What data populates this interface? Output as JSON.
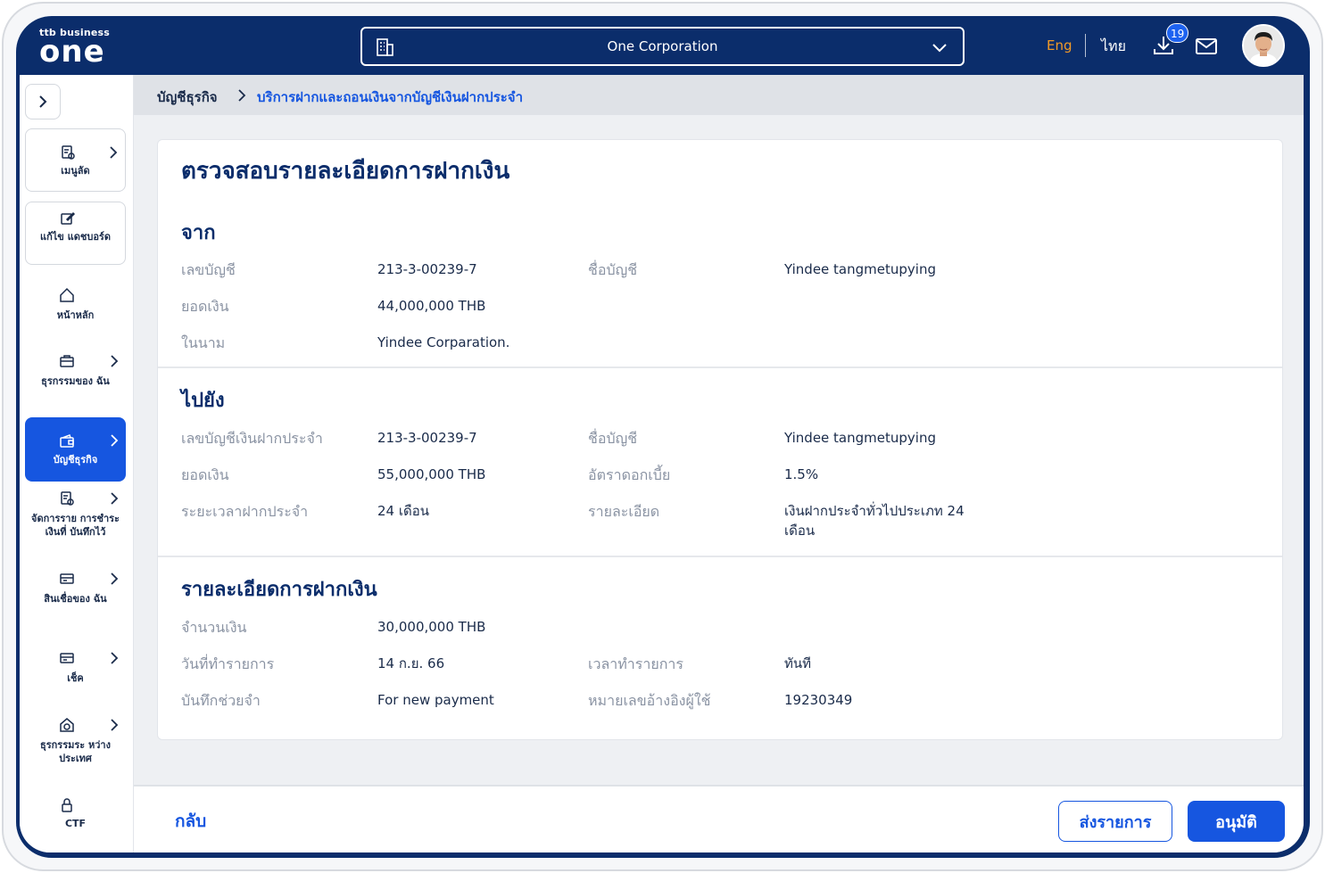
{
  "brand": {
    "small": "ttb business",
    "big": "one"
  },
  "header": {
    "corporation": "One Corporation",
    "lang_en": "Eng",
    "lang_th": "ไทย",
    "download_count": "19"
  },
  "sidebar": {
    "items": [
      {
        "label": "เมนูลัด"
      },
      {
        "label": "แก้ไข แดชบอร์ด"
      },
      {
        "label": "หน้าหลัก"
      },
      {
        "label": "ธุรกรรมของ ฉัน"
      },
      {
        "label": "บัญชีธุรกิจ"
      },
      {
        "label": "จัดการราย การชำระเงินที่ บันทึกไว้"
      },
      {
        "label": "สินเชื่อของ ฉัน"
      },
      {
        "label": "เช็ค"
      },
      {
        "label": "ธุรกรรมระ หว่างประเทศ"
      },
      {
        "label": "CTF"
      }
    ]
  },
  "breadcrumb": {
    "root": "บัญชีธุรกิจ",
    "current": "บริการฝากและถอนเงินจากบัญชีเงินฝากประจำ"
  },
  "page": {
    "title": "ตรวจสอบรายละเอียดการฝากเงิน",
    "from": {
      "title": "จาก",
      "account_no_label": "เลขบัญชี",
      "account_no": "213-3-00239-7",
      "account_name_label": "ชื่อบัญชี",
      "account_name": "Yindee tangmetupying",
      "balance_label": "ยอดเงิน",
      "balance": "44,000,000 THB",
      "on_behalf_label": "ในนาม",
      "on_behalf": "Yindee Corparation."
    },
    "to": {
      "title": "ไปยัง",
      "account_no_label": "เลขบัญชีเงินฝากประจำ",
      "account_no": "213-3-00239-7",
      "account_name_label": "ชื่อบัญชี",
      "account_name": "Yindee tangmetupying",
      "balance_label": "ยอดเงิน",
      "balance": "55,000,000 THB",
      "rate_label": "อัตราดอกเบี้ย",
      "rate": "1.5%",
      "term_label": "ระยะเวลาฝากประจำ",
      "term": "24 เดือน",
      "detail_label": "รายละเอียด",
      "detail_line1": "เงินฝากประจำทั่วไปประเภท 24",
      "detail_line2": "เดือน"
    },
    "deposit": {
      "title": "รายละเอียดการฝากเงิน",
      "amount_label": "จำนวนเงิน",
      "amount": "30,000,000 THB",
      "date_label": "วันที่ทำรายการ",
      "date": "14 ก.ย. 66",
      "time_label": "เวลาทำรายการ",
      "time": "ทันที",
      "memo_label": "บันทึกช่วยจำ",
      "memo": "For new payment",
      "ref_label": "หมายเลขอ้างอิงผู้ใช้",
      "ref": "19230349"
    }
  },
  "footer": {
    "back": "กลับ",
    "submit": "ส่งรายการ",
    "approve": "อนุมัติ"
  },
  "colors": {
    "navy": "#0b2d6b",
    "primary": "#1656e0",
    "accent": "#f49b26"
  }
}
